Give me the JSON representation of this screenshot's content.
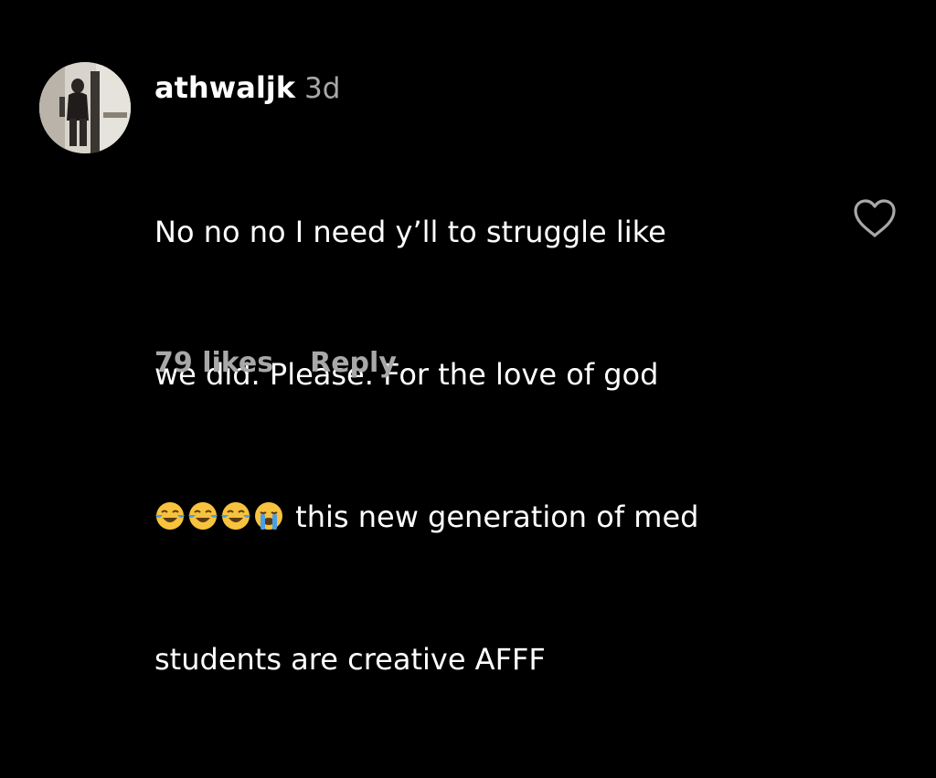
{
  "comment": {
    "username": "athwaljk",
    "timestamp": "3d",
    "lines": [
      "No no no I need y’ll to struggle like",
      "we did. Please. For the love of god",
      "this new generation of med",
      "students are creative AFFF"
    ],
    "emojis": [
      "face-with-tears-of-joy",
      "face-with-tears-of-joy",
      "face-with-tears-of-joy",
      "loudly-crying-face"
    ],
    "likes_label": "79 likes",
    "reply_label": "Reply",
    "like_icon": "heart-outline-icon"
  },
  "colors": {
    "background": "#000000",
    "primary_text": "#ffffff",
    "secondary_text": "#a8a8a8",
    "emoji_face": "#f7c23e",
    "emoji_tear": "#4a9fe8"
  }
}
